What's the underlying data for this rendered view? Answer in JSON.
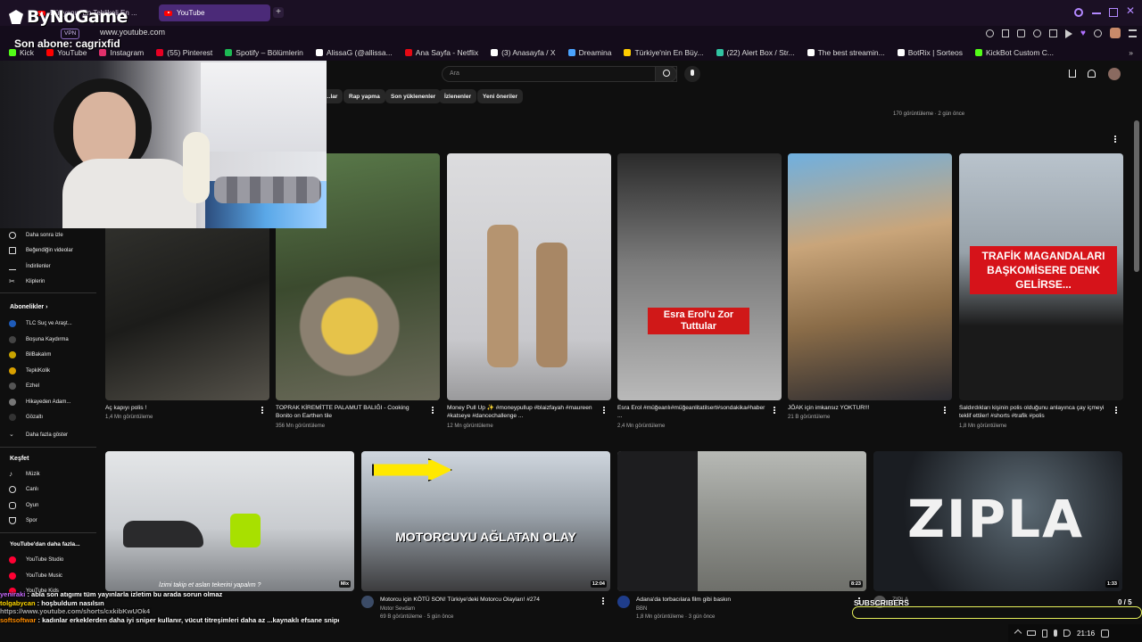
{
  "browser": {
    "tabs": [
      {
        "label": "Dünyanın En Tehlikeli En ..."
      },
      {
        "label": "YouTube"
      }
    ],
    "vpn_badge": "VPN",
    "url": "www.youtube.com"
  },
  "bookmarks": [
    {
      "label": "Kick",
      "color": "#53fc18"
    },
    {
      "label": "YouTube",
      "color": "#ff0000"
    },
    {
      "label": "Instagram",
      "color": "#e1306c"
    },
    {
      "label": "(55) Pinterest",
      "color": "#e60023"
    },
    {
      "label": "Spotify – Bölümlerin",
      "color": "#1db954"
    },
    {
      "label": "AlissaG (@allissa...",
      "color": "#ffffff"
    },
    {
      "label": "Ana Sayfa - Netflix",
      "color": "#e50914"
    },
    {
      "label": "(3) Anasayfa / X",
      "color": "#ffffff"
    },
    {
      "label": "Dreamina",
      "color": "#4aa3ff"
    },
    {
      "label": "Türkiye'nin En Büy...",
      "color": "#ffcc00"
    },
    {
      "label": "(22) Alert Box / Str...",
      "color": "#31c3a2"
    },
    {
      "label": "The best streamin...",
      "color": "#ffffff"
    },
    {
      "label": "BotRix | Sorteos",
      "color": "#ffffff"
    },
    {
      "label": "KickBot Custom C...",
      "color": "#53fc18"
    }
  ],
  "stream_overlay": {
    "logo": "ByNoGame",
    "last_sub_label": "Son abone: cagrixfid",
    "subscribers_label": "SUBSCRIBERS",
    "subscribers_count": "0 / 5"
  },
  "youtube": {
    "search_placeholder": "Ara",
    "chips": [
      "…lar",
      "Rap yapma",
      "Son yüklenenler",
      "İzlenenler",
      "Yeni öneriler"
    ],
    "prev_row_meta": [
      "170 görüntüleme · 2 gün önce"
    ],
    "sidebar": {
      "you_items": [
        "Daha sonra izle",
        "Beğendiğin videolar",
        "İndirilenler",
        "Kliplerin"
      ],
      "subs_header": "Abonelikler",
      "subs": [
        {
          "label": "TLC Suç ve Araşt...",
          "color": "#1e5bb8"
        },
        {
          "label": "Boşuna Kaydırma",
          "color": "#444"
        },
        {
          "label": "BilBakalım",
          "color": "#c9a400"
        },
        {
          "label": "TepkiKolik",
          "color": "#d9a000"
        },
        {
          "label": "Ezhel",
          "color": "#555"
        },
        {
          "label": "Hikayeden Adam...",
          "color": "#777"
        },
        {
          "label": "Gözaltı",
          "color": "#333"
        }
      ],
      "show_more": "Daha fazla göster",
      "explore_header": "Keşfet",
      "explore": [
        "Müzik",
        "Canlı",
        "Oyun",
        "Spor"
      ],
      "more_header": "YouTube'dan daha fazla...",
      "more": [
        "YouTube Studio",
        "YouTube Music",
        "YouTube Kids"
      ]
    },
    "shorts": [
      {
        "title": "Aç kapıyı polis !",
        "views": "1,4 Mn görüntüleme",
        "overlay": ""
      },
      {
        "title": "TOPRAK KİREMİTTE PALAMUT BALIĞI - Cooking Bonito on Earthen tile",
        "views": "356 Mn görüntüleme",
        "overlay": ""
      },
      {
        "title": "Money Pull Up ✨ #moneypullup #blaizfayah #maureen #katseye #dancechallenge ...",
        "views": "12 Mn görüntüleme",
        "overlay": ""
      },
      {
        "title": "Esra Erol #müğeanlı#müğeanlitatilsert#sondakika#haber ...",
        "views": "2,4 Mn görüntüleme",
        "overlay": "Esra Erol'u Zor Tuttular"
      },
      {
        "title": "JÖAK için imkansız YOKTUR!!!",
        "views": "21 B görüntüleme",
        "overlay": ""
      },
      {
        "title": "Saldırdıkları kişinin polis olduğunu anlayınca çay içmeyi teklif ettiler! #shorts #trafik #polis",
        "views": "1,8 Mn görüntüleme",
        "overlay": "TRAFİK MAGANDALARI BAŞKOMİSERE DENK GELİRSE..."
      }
    ],
    "videos": [
      {
        "title": "",
        "channel": "",
        "meta": "",
        "duration": "Mix",
        "overlay": "İzimi takip et aslan tekerini yapalım ?"
      },
      {
        "title": "Motorcu için KÖTÜ SON! Türkiye'deki Motorcu Olayları! #274",
        "channel": "Motor Sevdam",
        "meta": "69 B görüntüleme · 5 gün önce",
        "duration": "12:04",
        "overlay": "MOTORCUYU AĞLATAN OLAY"
      },
      {
        "title": "Adana'da torbacılara film gibi baskın",
        "channel": "BBN",
        "meta": "1,8 Mn görüntüleme · 3 gün önce",
        "duration": "8:23",
        "overlay": ""
      },
      {
        "title": "ZIPLA",
        "channel": "",
        "meta": "",
        "duration": "1:33",
        "overlay": "ZIPLA"
      }
    ]
  },
  "chat": [
    {
      "user": "yeniraki",
      "color": "#c86bff",
      "text": "abla son atıgımı tüm yayınlarla izletim bu arada sorun olmaz"
    },
    {
      "user": "tolgabycan",
      "color": "#ffd700",
      "text": "hoşbuldum nasılsın"
    },
    {
      "user": "",
      "color": "#aaaaaa",
      "text": "https://www.youtube.com/shorts/cxkibKwUOk4"
    },
    {
      "user": "softsoftwar",
      "color": "#ff8c00",
      "text": "kadınlar erkeklerden daha iyi sniper kullanır, vücut titreşimleri daha az ...kaynaklı efsane sniper kadınlar var 100 den fazla kill'i vadr"
    }
  ],
  "taskbar": {
    "time": "21:16"
  }
}
